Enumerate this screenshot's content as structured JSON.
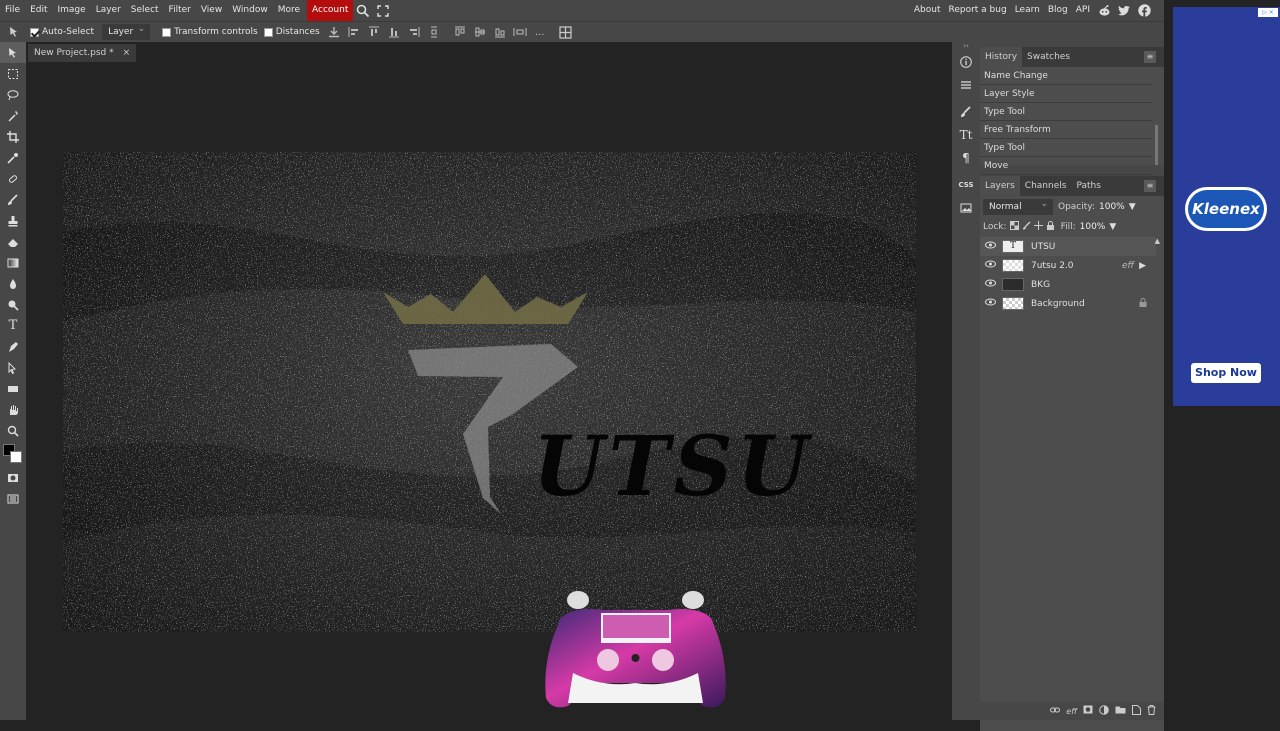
{
  "menu": {
    "items": [
      "File",
      "Edit",
      "Image",
      "Layer",
      "Select",
      "Filter",
      "View",
      "Window",
      "More"
    ],
    "account": "Account",
    "right_links": [
      "About",
      "Report a bug",
      "Learn",
      "Blog",
      "API"
    ]
  },
  "options": {
    "auto_select": "Auto-Select",
    "target": "Layer",
    "transform_controls": "Transform controls",
    "distances": "Distances",
    "more": "..."
  },
  "document": {
    "tab_name": "New Project.psd *",
    "close": "×"
  },
  "canvas_art": {
    "word": "UTSU"
  },
  "history": {
    "tabs": [
      "History",
      "Swatches"
    ],
    "items": [
      "Name Change",
      "Layer Style",
      "Type Tool",
      "Free Transform",
      "Type Tool",
      "Move"
    ]
  },
  "layers": {
    "tabs": [
      "Layers",
      "Channels",
      "Paths"
    ],
    "blend_mode": "Normal",
    "opacity_label": "Opacity:",
    "opacity_value": "100%",
    "lock_label": "Lock:",
    "fill_label": "Fill:",
    "fill_value": "100%",
    "items": [
      {
        "name": "UTSU",
        "type": "text"
      },
      {
        "name": "7utsu 2.0",
        "type": "image",
        "fx": "eff"
      },
      {
        "name": "BKG",
        "type": "image"
      },
      {
        "name": "Background",
        "type": "checker"
      }
    ]
  },
  "ad": {
    "brand": "Kleenex",
    "cta": "Shop Now"
  },
  "colors": {
    "menubar": "#474747",
    "workspace": "#232323",
    "account": "#b30d0d",
    "ad_bg": "#2a3d9a"
  }
}
